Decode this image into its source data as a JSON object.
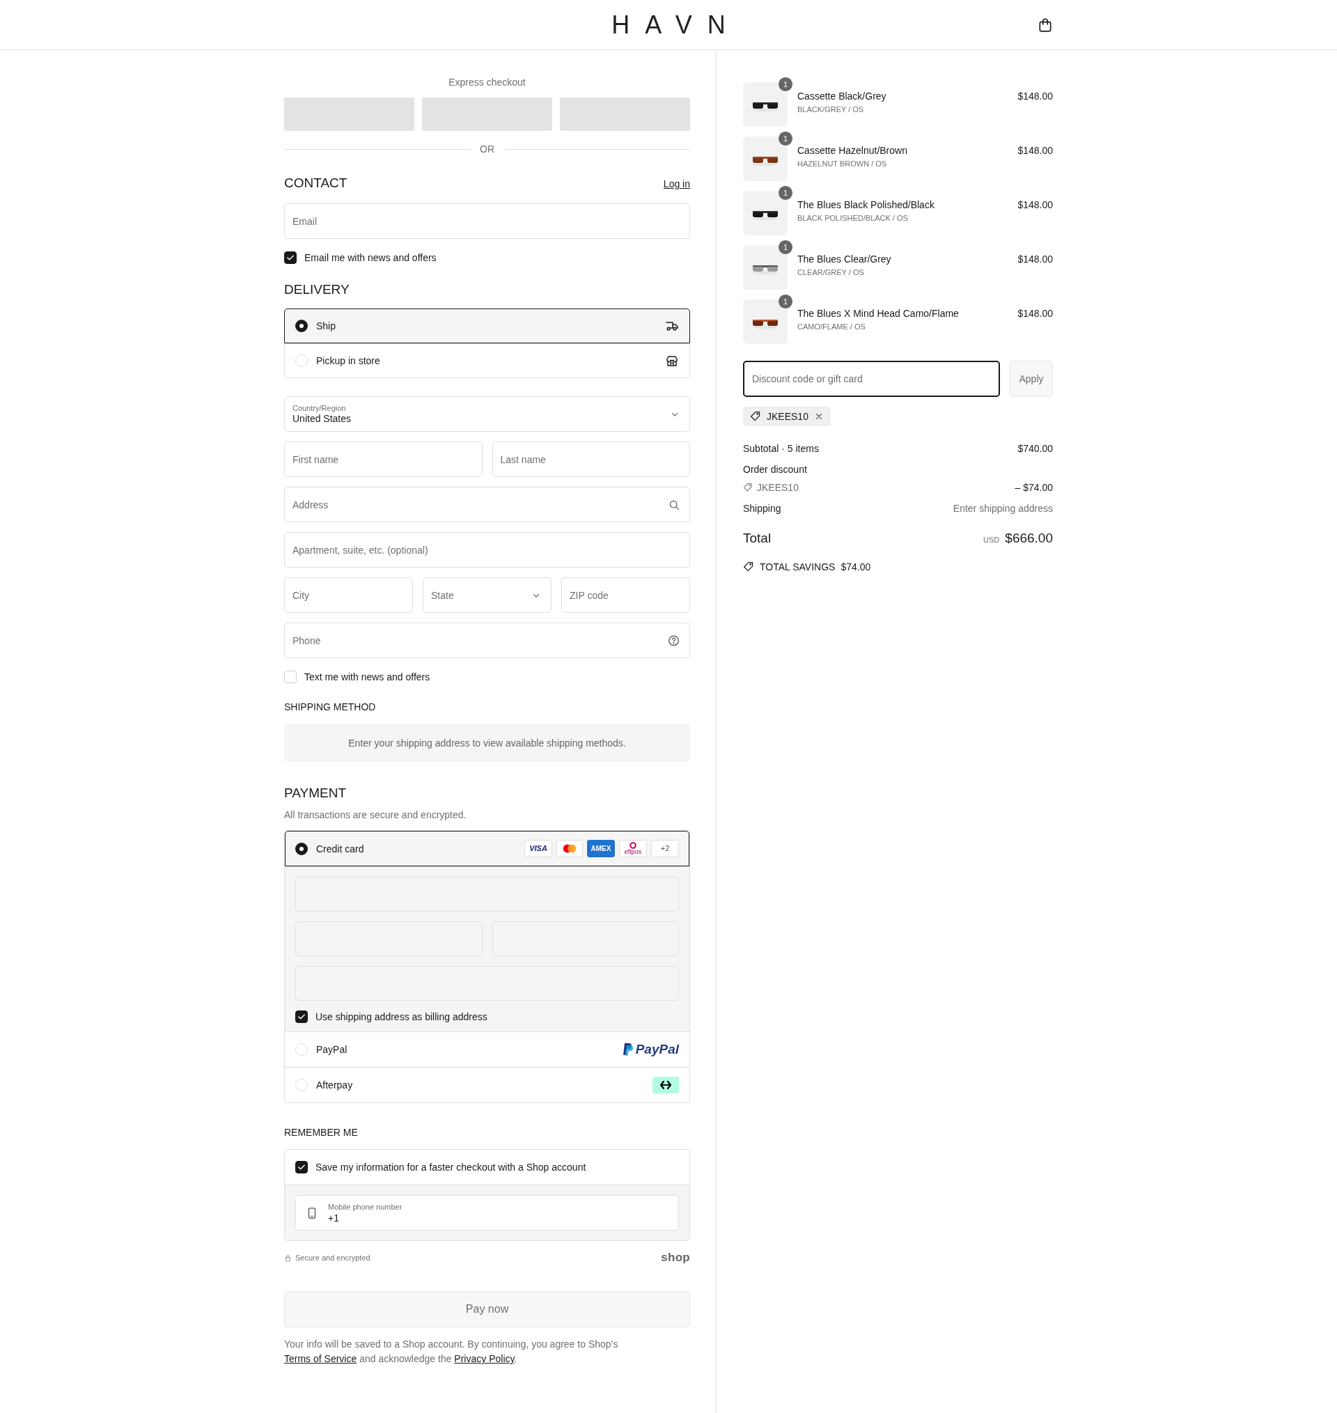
{
  "header": {
    "logo": "HAVN"
  },
  "express_checkout": {
    "title": "Express checkout",
    "separator": "OR"
  },
  "contact": {
    "heading": "CONTACT",
    "login_link": "Log in",
    "email": {
      "placeholder": "Email"
    },
    "newsletter": {
      "label": "Email me with news and offers",
      "checked": true
    }
  },
  "delivery": {
    "heading": "DELIVERY",
    "options": [
      {
        "label": "Ship",
        "kind": "ship",
        "selected": true
      },
      {
        "label": "Pickup in store",
        "kind": "pickup",
        "selected": false
      }
    ]
  },
  "address": {
    "country": {
      "label": "Country/Region",
      "value": "United States"
    },
    "rows": [
      {
        "fields": [
          {
            "placeholder": "First name",
            "kind": "text"
          },
          {
            "placeholder": "Last name",
            "kind": "text"
          }
        ]
      },
      {
        "fields": [
          {
            "placeholder": "Address",
            "kind": "search"
          }
        ]
      },
      {
        "fields": [
          {
            "placeholder": "Apartment, suite, etc. (optional)",
            "kind": "text"
          }
        ]
      },
      {
        "fields": [
          {
            "placeholder": "City",
            "kind": "text"
          },
          {
            "placeholder": "State",
            "kind": "select"
          },
          {
            "placeholder": "ZIP code",
            "kind": "text"
          }
        ]
      },
      {
        "fields": [
          {
            "placeholder": "Phone",
            "kind": "help"
          }
        ]
      }
    ],
    "sms": {
      "label": "Text me with news and offers",
      "checked": false
    }
  },
  "shipping_method": {
    "heading": "SHIPPING METHOD",
    "message": "Enter your shipping address to view available shipping methods."
  },
  "payment": {
    "heading": "PAYMENT",
    "subtitle": "All transactions are secure and encrypted.",
    "methods": [
      {
        "label": "Credit card",
        "kind": "card",
        "selected": true,
        "brands": [
          {
            "kind": "visa",
            "label": "VISA"
          },
          {
            "kind": "mastercard"
          },
          {
            "kind": "amex",
            "label": "AMEX"
          },
          {
            "kind": "eftpos",
            "label": "eftpos"
          },
          {
            "kind": "more",
            "label": "+2"
          }
        ],
        "billing": {
          "label": "Use shipping address as billing address",
          "checked": true
        }
      },
      {
        "label": "PayPal",
        "kind": "paypal",
        "selected": false,
        "logo": "PayPal"
      },
      {
        "label": "Afterpay",
        "kind": "afterpay",
        "selected": false
      }
    ]
  },
  "remember_me": {
    "heading": "REMEMBER ME",
    "save": {
      "label": "Save my information for a faster checkout with a Shop account",
      "checked": true
    },
    "phone": {
      "label": "Mobile phone number",
      "value": "+1"
    }
  },
  "secure_note": "Secure and encrypted",
  "shop_logo": "shop",
  "pay_button": {
    "label": "Pay now",
    "disabled": true
  },
  "legal": {
    "before": "Your info will be saved to a Shop account. By continuing, you agree to Shop’s ",
    "terms_link": "Terms of Service",
    "middle": " and acknowledge the ",
    "privacy_link": "Privacy Policy",
    "after": "."
  },
  "summary": {
    "items": [
      {
        "name": "Cassette Black/Grey",
        "variant": "BLACK/GREY / OS",
        "price": "$148.00",
        "quantity": "1"
      },
      {
        "name": "Cassette Hazelnut/Brown",
        "variant": "HAZELNUT BROWN / OS",
        "price": "$148.00",
        "quantity": "1"
      },
      {
        "name": "The Blues Black Polished/Black",
        "variant": "BLACK POLISHED/BLACK / OS",
        "price": "$148.00",
        "quantity": "1"
      },
      {
        "name": "The Blues Clear/Grey",
        "variant": "CLEAR/GREY / OS",
        "price": "$148.00",
        "quantity": "1"
      },
      {
        "name": "The Blues X Mind Head Camo/Flame",
        "variant": "CAMO/FLAME / OS",
        "price": "$148.00",
        "quantity": "1"
      }
    ],
    "discount": {
      "placeholder": "Discount code or gift card",
      "apply": "Apply"
    },
    "applied_code": "JKEES10",
    "subtotal_label": "Subtotal · 5 items",
    "subtotal": "$740.00",
    "discount_label": "Order discount",
    "discount_code": "JKEES10",
    "discount_amount": "– $74.00",
    "shipping_label": "Shipping",
    "shipping_value": "Enter shipping address",
    "total_label": "Total",
    "currency": "USD",
    "total": "$666.00",
    "savings_label": "TOTAL SAVINGS",
    "savings": "$74.00"
  }
}
